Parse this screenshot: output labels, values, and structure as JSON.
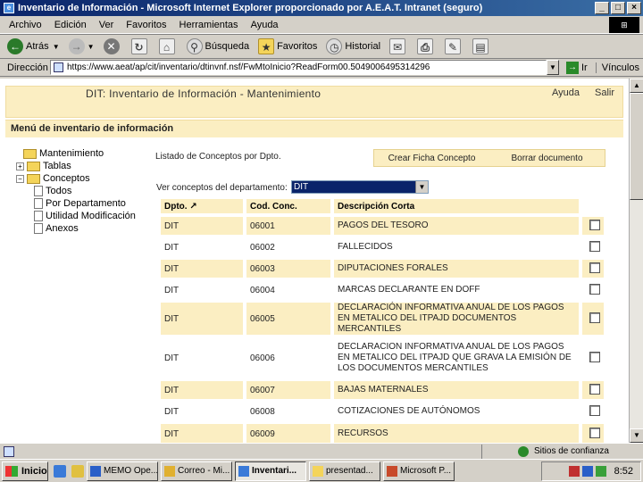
{
  "window": {
    "title": "Inventario de Información - Microsoft Internet Explorer proporcionado por A.E.A.T. Intranet (seguro)",
    "controls": [
      "_",
      "□",
      "×"
    ]
  },
  "menubar": {
    "items": [
      "Archivo",
      "Edición",
      "Ver",
      "Favoritos",
      "Herramientas",
      "Ayuda"
    ]
  },
  "toolbar": {
    "back": "Atrás",
    "search": "Búsqueda",
    "favorites": "Favoritos",
    "history": "Historial"
  },
  "address": {
    "label": "Dirección",
    "url": "https://www.aeat/ap/cit/inventario/dtinvnf.nsf/FwMtoInicio?ReadForm00.5049006495314296",
    "go": "Ir",
    "links": "Vínculos"
  },
  "page": {
    "title": "DIT: Inventario de Información - Mantenimiento",
    "help": "Ayuda",
    "exit": "Salir",
    "menu_title": "Menú de inventario de información"
  },
  "tree": {
    "root": "Mantenimiento",
    "tablas": "Tablas",
    "conceptos": "Conceptos",
    "todos": "Todos",
    "por_departamento": "Por Departamento",
    "utilidad": "Utilidad Modificación",
    "anexos": "Anexos"
  },
  "listing": {
    "label": "Listado de Conceptos por Dpto.",
    "create_button": "Crear Ficha Concepto",
    "delete_button": "Borrar documento",
    "dept_label": "Ver conceptos del departamento:",
    "dept_selected": "DIT"
  },
  "table": {
    "headers": [
      "Dpto. ↗",
      "Cod. Conc.",
      "Descripción Corta"
    ],
    "rows": [
      {
        "dpto": "DIT",
        "cod": "06001",
        "desc": "PAGOS DEL TESORO"
      },
      {
        "dpto": "DIT",
        "cod": "06002",
        "desc": "FALLECIDOS"
      },
      {
        "dpto": "DIT",
        "cod": "06003",
        "desc": "DIPUTACIONES FORALES"
      },
      {
        "dpto": "DIT",
        "cod": "06004",
        "desc": "MARCAS DECLARANTE EN DOFF"
      },
      {
        "dpto": "DIT",
        "cod": "06005",
        "desc": "DECLARACIÓN INFORMATIVA ANUAL DE LOS PAGOS EN METALICO DEL ITPAJD DOCUMENTOS MERCANTILES"
      },
      {
        "dpto": "DIT",
        "cod": "06006",
        "desc": "DECLARACION INFORMATIVA ANUAL DE LOS PAGOS EN METALICO DEL ITPAJD QUE GRAVA LA EMISIÓN DE LOS DOCUMENTOS MERCANTILES"
      },
      {
        "dpto": "DIT",
        "cod": "06007",
        "desc": "BAJAS MATERNALES"
      },
      {
        "dpto": "DIT",
        "cod": "06008",
        "desc": "COTIZACIONES DE AUTÓNOMOS"
      },
      {
        "dpto": "DIT",
        "cod": "06009",
        "desc": "RECURSOS"
      }
    ]
  },
  "status": {
    "zone": "Sitios de confianza"
  },
  "taskbar": {
    "start": "Inicio",
    "tasks": [
      "MEMO Ope...",
      "Correo - Mi...",
      "Inventari...",
      "presentad...",
      "Microsoft P..."
    ],
    "clock": "8:52"
  }
}
